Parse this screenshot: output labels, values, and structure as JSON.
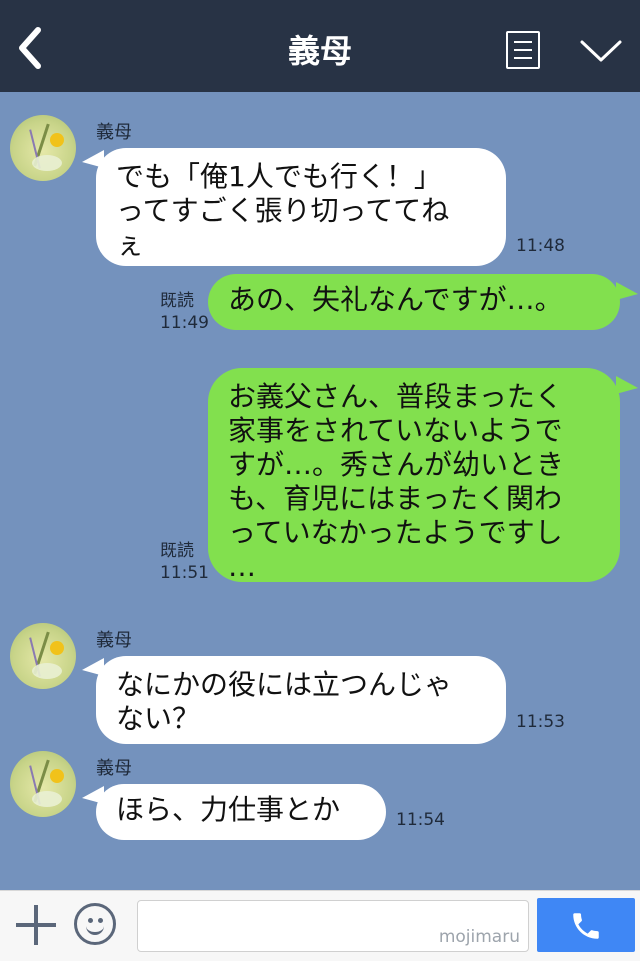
{
  "header": {
    "title": "義母"
  },
  "messages": [
    {
      "sender": "義母",
      "lines": [
        "でも「俺1人でも行く！」",
        "ってすごく張り切っててね",
        "ぇ"
      ],
      "time": "11:48"
    },
    {
      "lines": [
        "あの、失礼なんですが…。"
      ],
      "read": "既読",
      "time": "11:49"
    },
    {
      "lines": [
        "お義父さん、普段まったく",
        "家事をされていないようで",
        "すが…。秀さんが幼いとき",
        "も、育児にはまったく関わ",
        "っていなかったようですし",
        "…"
      ],
      "read": "既読",
      "time": "11:51"
    },
    {
      "sender": "義母",
      "lines": [
        "なにかの役には立つんじゃ",
        "ない？"
      ],
      "time": "11:53"
    },
    {
      "sender": "義母",
      "lines": [
        "ほら、力仕事とか"
      ],
      "time": "11:54"
    }
  ],
  "footer": {
    "watermark": "mojimaru",
    "input_value": ""
  },
  "colors": {
    "header_bg": "#283345",
    "chat_bg": "#7492bd",
    "outgoing_bubble": "#82e04e",
    "incoming_bubble": "#ffffff",
    "call_button": "#3f87f5"
  },
  "icons": {
    "back": "chevron-left-icon",
    "menu": "list-icon",
    "collapse": "chevron-down-icon",
    "add": "plus-icon",
    "sticker": "smiley-icon",
    "call": "phone-icon"
  }
}
